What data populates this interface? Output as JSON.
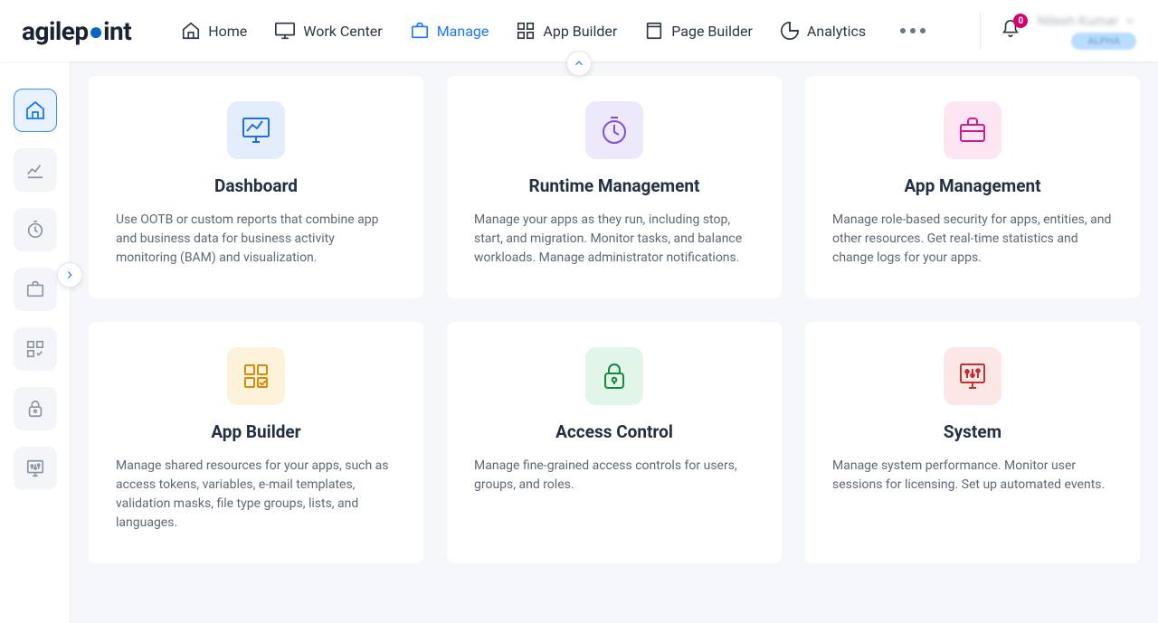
{
  "brand": {
    "name_part1": "agilep",
    "name_part2": "int"
  },
  "nav": {
    "home": "Home",
    "work_center": "Work Center",
    "manage": "Manage",
    "app_builder": "App Builder",
    "page_builder": "Page Builder",
    "analytics": "Analytics"
  },
  "notifications": {
    "count": "0"
  },
  "user": {
    "display_name": "Nilesh Kumar",
    "tag": "ALPHA"
  },
  "cards": {
    "dashboard": {
      "title": "Dashboard",
      "desc": "Use OOTB or custom reports that combine app and business data for business activity monitoring (BAM) and visualization."
    },
    "runtime": {
      "title": "Runtime Management",
      "desc": "Manage your apps as they run, including stop, start, and migration. Monitor tasks, and balance workloads. Manage administrator notifications."
    },
    "app_mgmt": {
      "title": "App Management",
      "desc": "Manage role-based security for apps, entities, and other resources. Get real-time statistics and change logs for your apps."
    },
    "app_builder": {
      "title": "App Builder",
      "desc": "Manage shared resources for your apps, such as access tokens, variables, e-mail templates, validation masks, file type groups, lists, and languages."
    },
    "access": {
      "title": "Access Control",
      "desc": "Manage fine-grained access controls for users, groups, and roles."
    },
    "system": {
      "title": "System",
      "desc": "Manage system performance. Monitor user sessions for licensing. Set up automated events."
    }
  }
}
